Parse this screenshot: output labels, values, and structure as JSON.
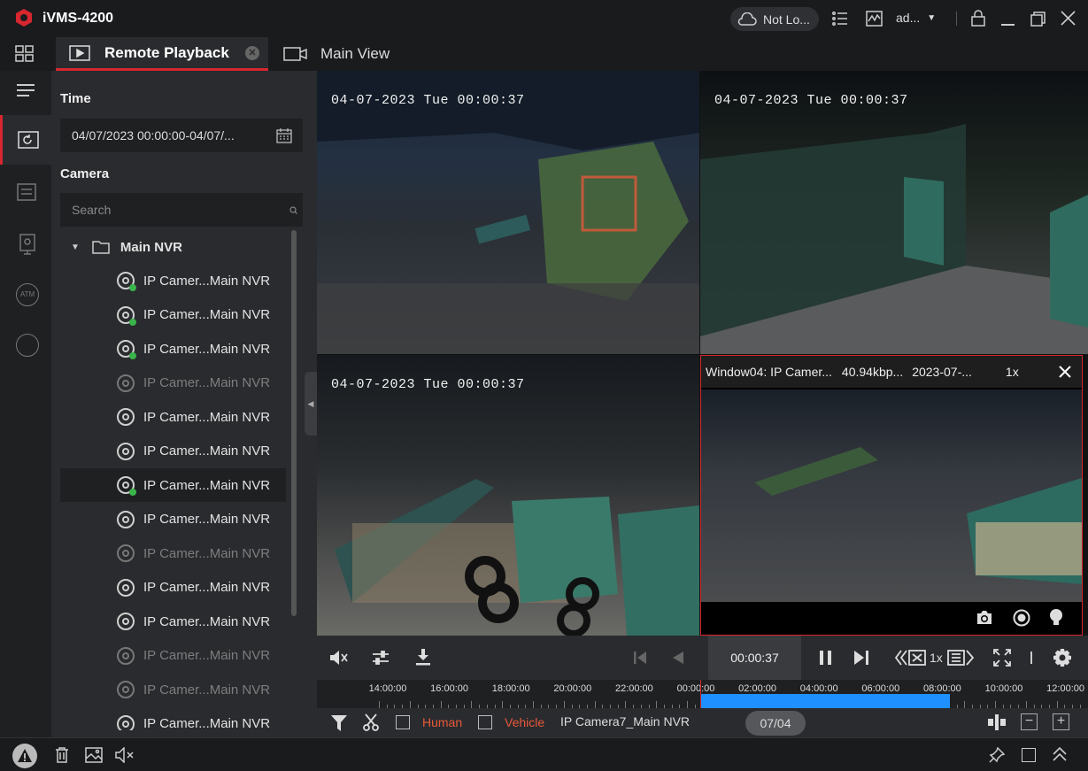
{
  "app": {
    "title": "iVMS-4200"
  },
  "titlebar": {
    "cloud_status": "Not Lo...",
    "user": "ad..."
  },
  "tabs": [
    {
      "label": "Remote Playback",
      "active": true
    },
    {
      "label": "Main View",
      "active": false
    }
  ],
  "panel": {
    "time_label": "Time",
    "time_range": "04/07/2023 00:00:00-04/07/...",
    "camera_label": "Camera",
    "search_placeholder": "Search",
    "root": "Main NVR",
    "cameras": [
      {
        "label": "IP Camer...Main NVR",
        "online": true,
        "dim": false,
        "selected": false
      },
      {
        "label": "IP Camer...Main NVR",
        "online": true,
        "dim": false,
        "selected": false
      },
      {
        "label": "IP Camer...Main NVR",
        "online": true,
        "dim": false,
        "selected": false
      },
      {
        "label": "IP Camer...Main NVR",
        "online": false,
        "dim": true,
        "selected": false
      },
      {
        "label": "IP Camer...Main NVR",
        "online": false,
        "dim": false,
        "selected": false
      },
      {
        "label": "IP Camer...Main NVR",
        "online": false,
        "dim": false,
        "selected": false
      },
      {
        "label": "IP Camer...Main NVR",
        "online": true,
        "dim": false,
        "selected": true
      },
      {
        "label": "IP Camer...Main NVR",
        "online": false,
        "dim": false,
        "selected": false
      },
      {
        "label": "IP Camer...Main NVR",
        "online": false,
        "dim": true,
        "selected": false
      },
      {
        "label": "IP Camer...Main NVR",
        "online": false,
        "dim": false,
        "selected": false
      },
      {
        "label": "IP Camer...Main NVR",
        "online": false,
        "dim": false,
        "selected": false
      },
      {
        "label": "IP Camer...Main NVR",
        "online": false,
        "dim": true,
        "selected": false
      },
      {
        "label": "IP Camer...Main NVR",
        "online": false,
        "dim": true,
        "selected": false
      },
      {
        "label": "IP Camer...Main NVR",
        "online": false,
        "dim": false,
        "selected": false
      }
    ]
  },
  "video": {
    "osd1": "04-07-2023 Tue 00:00:37",
    "osd2": "04-07-2023 Tue 00:00:37",
    "osd3": "04-07-2023 Tue 00:00:37",
    "window4_title": "Window04: IP Camer...",
    "window4_bitrate": "40.94kbp...",
    "window4_date": "2023-07-...",
    "window4_speed": "1x"
  },
  "controls": {
    "current_time": "00:00:37",
    "speed": "1x"
  },
  "timeline": {
    "labels": [
      "14:00:00",
      "16:00:00",
      "18:00:00",
      "20:00:00",
      "22:00:00",
      "00:00:00",
      "02:00:00",
      "04:00:00",
      "06:00:00",
      "08:00:00",
      "10:00:00",
      "12:00:00"
    ],
    "date_badge": "07/04"
  },
  "filter": {
    "human": "Human",
    "vehicle": "Vehicle",
    "camera_name": "IP Camera7_Main NVR"
  },
  "colors": {
    "accent": "#d6262f",
    "recording": "#1e90ff",
    "online": "#3ab54a"
  }
}
